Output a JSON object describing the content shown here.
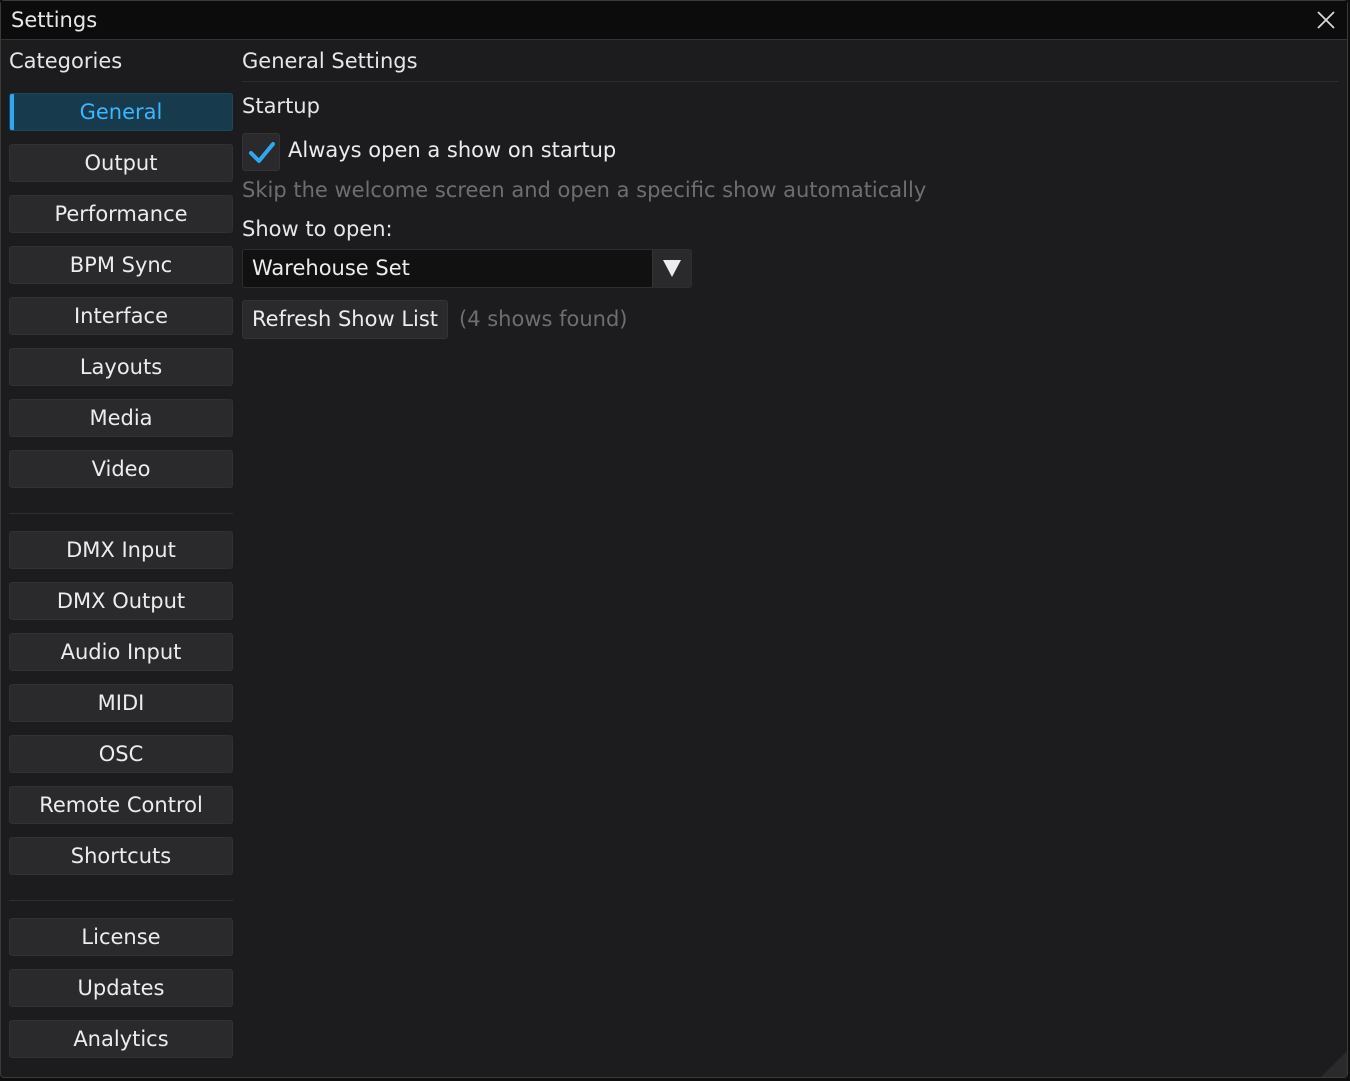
{
  "window": {
    "title": "Settings"
  },
  "sidebar": {
    "heading": "Categories",
    "groups": [
      [
        "General",
        "Output",
        "Performance",
        "BPM Sync",
        "Interface",
        "Layouts",
        "Media",
        "Video"
      ],
      [
        "DMX Input",
        "DMX Output",
        "Audio Input",
        "MIDI",
        "OSC",
        "Remote Control",
        "Shortcuts"
      ],
      [
        "License",
        "Updates",
        "Analytics"
      ]
    ],
    "selected": "General"
  },
  "main": {
    "heading": "General Settings",
    "section_title": "Startup",
    "always_open": {
      "label": "Always open a show on startup",
      "checked": true
    },
    "hint": "Skip the welcome screen and open a specific show automatically",
    "show_to_open_label": "Show to open:",
    "show_select_value": "Warehouse Set",
    "refresh_label": "Refresh Show List",
    "shows_found": "(4 shows found)"
  },
  "colors": {
    "accent": "#2ea8f0",
    "background": "#1c1c1e",
    "button": "#2a2a2c"
  },
  "icons": {
    "close": "close-icon",
    "check": "checkmark-icon",
    "dropdown": "triangle-down-icon",
    "resize": "resize-grip-icon"
  }
}
